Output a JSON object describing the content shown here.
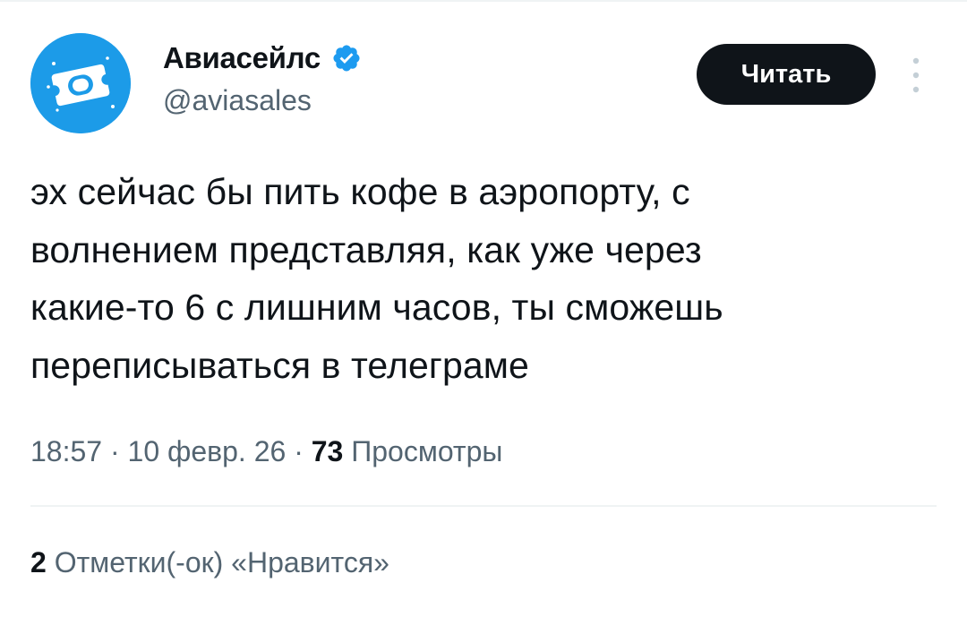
{
  "author": {
    "display_name": "Авиасейлс",
    "handle": "@aviasales",
    "verified": true,
    "avatar_icon": "airplane-window-icon",
    "avatar_color": "#1c9be8"
  },
  "actions": {
    "follow_label": "Читать",
    "more_icon": "more-vertical-icon"
  },
  "tweet": {
    "text": "эх сейчас бы пить кофе в аэропорту, с\nволнением представляя, как уже через\nкакие-то 6 с лишним часов, ты сможешь\nпереписываться в телеграме"
  },
  "meta": {
    "time": "18:57",
    "separator": " · ",
    "date": "10 февр. 26",
    "views_count": "73",
    "views_label": "Просмотры"
  },
  "engagement": {
    "likes_count": "2",
    "likes_label": "Отметки(-ок) «Нравится»"
  },
  "colors": {
    "text_primary": "#0f1419",
    "text_secondary": "#536471",
    "verified_blue": "#1d9bf0",
    "button_bg": "#0f1419"
  }
}
